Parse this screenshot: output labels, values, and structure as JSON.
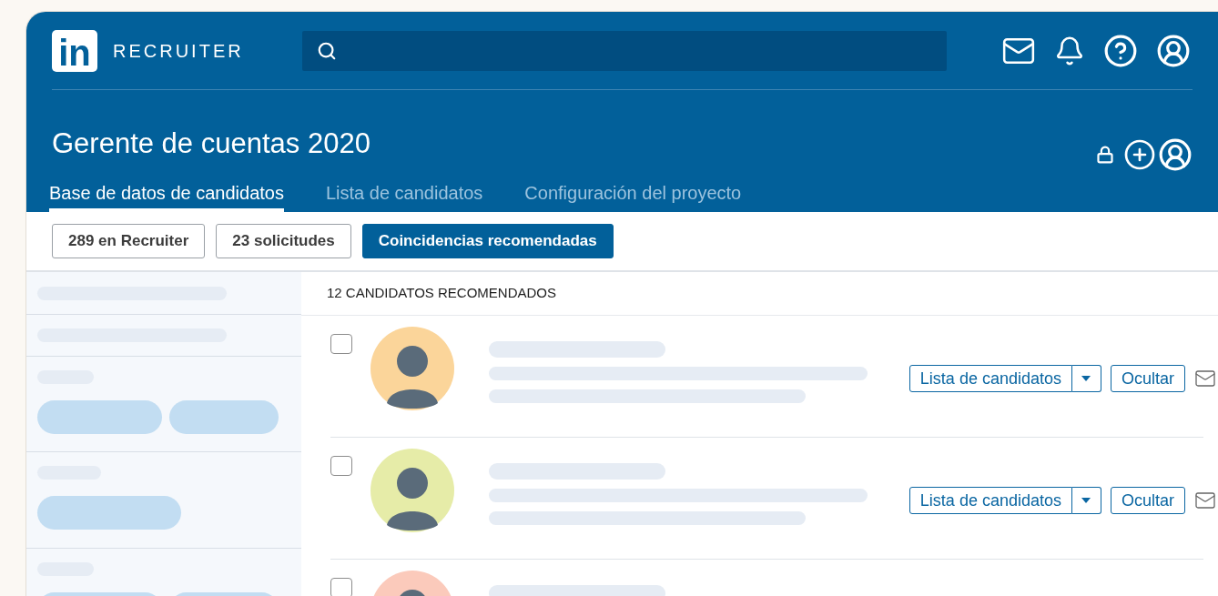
{
  "brand": {
    "logo_mark": "in",
    "product": "RECRUITER"
  },
  "project": {
    "title": "Gerente de cuentas 2020"
  },
  "tabs": [
    {
      "label": "Base de datos de candidatos",
      "selected": true
    },
    {
      "label": "Lista de candidatos",
      "selected": false
    },
    {
      "label": "Configuración del proyecto",
      "selected": false
    }
  ],
  "filters": [
    {
      "label": "289 en Recruiter",
      "selected": false
    },
    {
      "label": "23 solicitudes",
      "selected": false
    },
    {
      "label": "Coincidencias recomendadas",
      "selected": true
    }
  ],
  "results": {
    "heading": "12 CANDIDATOS RECOMENDADOS"
  },
  "candidates": [
    {
      "checked": false,
      "color": "#fbd59a",
      "actions": {
        "list_button": "Lista de candidatos",
        "hide_button": "Ocultar"
      }
    },
    {
      "checked": false,
      "color": "#e6eca8",
      "actions": {
        "list_button": "Lista de candidatos",
        "hide_button": "Ocultar"
      }
    },
    {
      "checked": false,
      "color": "#fbcabb"
    }
  ]
}
